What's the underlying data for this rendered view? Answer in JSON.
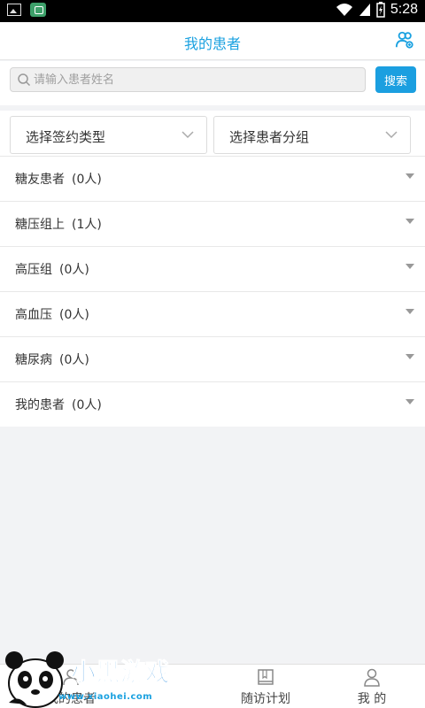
{
  "status_bar": {
    "time": "5:28"
  },
  "header": {
    "title": "我的患者",
    "right_icon": "contacts-icon"
  },
  "search": {
    "placeholder": "请输入患者姓名",
    "value": "",
    "button_label": "搜索"
  },
  "filters": [
    {
      "label": "选择签约类型"
    },
    {
      "label": "选择患者分组"
    }
  ],
  "groups": [
    {
      "name": "糖友患者",
      "count": "(0人)"
    },
    {
      "name": "糖压组上",
      "count": "(1人)"
    },
    {
      "name": "高压组",
      "count": "(0人)"
    },
    {
      "name": "高血压",
      "count": "(0人)"
    },
    {
      "name": "糖尿病",
      "count": "(0人)"
    },
    {
      "name": "我的患者",
      "count": "(0人)"
    }
  ],
  "tabbar": {
    "tabs": [
      {
        "label": "我的患者",
        "icon": "patients-icon"
      },
      {
        "label": "随访计划",
        "icon": "book-icon"
      },
      {
        "label": "我 的",
        "icon": "user-icon"
      }
    ]
  },
  "watermark": {
    "text": "小黑游戏",
    "url": "www.xiaohei.com"
  },
  "colors": {
    "accent": "#1b9fe0",
    "background": "#f2f3f5"
  }
}
